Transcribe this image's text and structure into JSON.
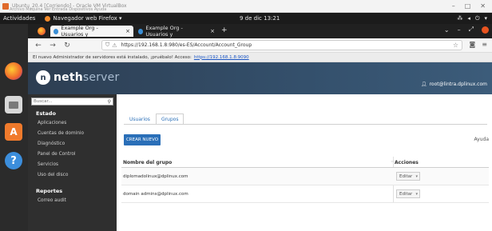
{
  "vm_window": {
    "title": "Ubuntu_20.4 [Corriendo] - Oracle VM VirtualBox",
    "menu": "Archivo   Máquina   Ver   Entrada   Dispositivos   Ayuda"
  },
  "gnome_bar": {
    "activities": "Actividades",
    "app_menu": "Navegador web Firefox ▾",
    "clock": "9 de dic  13:21"
  },
  "firefox": {
    "tabs": [
      {
        "label": "Example Org - Usuarios y",
        "active": true
      },
      {
        "label": "Example Org - Usuarios y",
        "active": false
      }
    ],
    "url": "https://192.168.1.8:980/es-ES/Account/Account_Group",
    "notice_text": "El nuevo Administrador de servidores está instalado, ¡pruébalo! Acceso:",
    "notice_link": "https://192.168.1.8:9090"
  },
  "nethserver": {
    "brand_bold": "neth",
    "brand_light": "server",
    "user": "root@lintra.dplinux.com",
    "search_placeholder": "Buscar...",
    "sections": [
      {
        "title": "Estado",
        "items": [
          "Aplicaciones",
          "Cuentas de dominio",
          "Diagnóstico",
          "Panel de Control",
          "Servicios",
          "Uso del disco"
        ]
      },
      {
        "title": "Reportes",
        "items": [
          "Correo audit"
        ]
      }
    ]
  },
  "content": {
    "tabs": [
      "Usuarios",
      "Grupos"
    ],
    "active_tab": "Grupos",
    "create_button": "CREAR NUEVO",
    "help": "Ayuda",
    "table": {
      "col_name": "Nombre del grupo",
      "col_actions": "Acciones",
      "rows": [
        {
          "name": "diplomadolinux@dplinux.com",
          "action": "Editar"
        },
        {
          "name": "domain admins@dplinux.com",
          "action": "Editar"
        }
      ]
    }
  },
  "colors": {
    "accent": "#2a6fb8",
    "header": "#2d3e52",
    "sidebar": "#2f2f2f",
    "dock": "#2b2b2b"
  }
}
